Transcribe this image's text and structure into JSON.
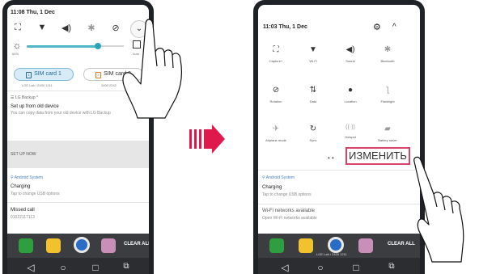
{
  "left_panel": {
    "status_time": "11:08 Thu, 1 Dec",
    "quick_icons": [
      "nfc-icon",
      "wifi-icon",
      "sound-icon",
      "bluetooth-icon",
      "rotation-lock-icon"
    ],
    "expand_icon": "chevron-down-icon",
    "brightness_small": "65%",
    "auto_label": "Auto",
    "sim1_label": "SIM card 1",
    "sim2_label": "SIM card 2",
    "sim1_sub": "LGE Lab / 2400 1211",
    "sim2_sub": "2400 2242",
    "backup_app": "LG Backup",
    "backup_title": "Set up from old device",
    "backup_desc": "You can copy data from your old device with LG Backup",
    "setup_now": "SET UP NOW",
    "android_system": "Android System",
    "charging_title": "Charging",
    "charging_desc": "Tap to change USB options",
    "missed_call_title": "Missed call",
    "missed_call_number": "01022117113"
  },
  "right_panel": {
    "status_time": "11:03 Thu, 1 Dec",
    "tiles": [
      {
        "icon": "nfc-icon",
        "label": "Capture+"
      },
      {
        "icon": "wifi-icon",
        "label": "Wi-Fi"
      },
      {
        "icon": "sound-icon",
        "label": "Sound"
      },
      {
        "icon": "bluetooth-icon",
        "label": "Bluetooth"
      },
      {
        "icon": "rotation-icon",
        "label": "Rotation"
      },
      {
        "icon": "data-icon",
        "label": "Data"
      },
      {
        "icon": "location-icon",
        "label": "Location"
      },
      {
        "icon": "flashlight-icon",
        "label": "Flashlight"
      },
      {
        "icon": "airplane-icon",
        "label": "Airplane mode"
      },
      {
        "icon": "sync-icon",
        "label": "Sync"
      },
      {
        "icon": "hotspot-icon",
        "label": "Hotspot"
      },
      {
        "icon": "battery-saver-icon",
        "label": "Battery saver"
      }
    ],
    "edit_label": "ИЗМЕНИТЬ",
    "android_system": "Android System",
    "charging_title": "Charging",
    "charging_desc": "Tap to change USB options",
    "wifi_title": "Wi-Fi networks available",
    "wifi_desc": "Open Wi-Fi networks available",
    "dock_sub": "LGE Lab / 2400 1211"
  },
  "dock": {
    "clear_all": "CLEAR ALL",
    "app_colors": [
      "#2e9e3e",
      "#f2c12e",
      "#2b6cc4",
      "#c88fb8"
    ]
  },
  "colors": {
    "accent": "#4fb8c7",
    "arrow": "#e0194d",
    "highlight": "#d9426a"
  }
}
